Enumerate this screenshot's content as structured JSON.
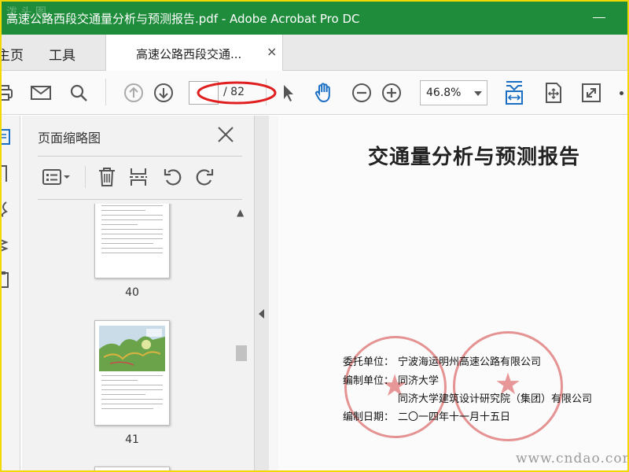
{
  "window": {
    "title": "高速公路西段交通量分析与预测报告.pdf - Adobe Acrobat Pro DC",
    "watermark": "泼 头 图"
  },
  "menubar": {
    "home_label": "主页",
    "tools_label": "工具",
    "tab_label": "高速公路西段交通...",
    "tab_close": "×"
  },
  "toolbar": {
    "page_total": "/ 82",
    "zoom": "46.8%",
    "icons": [
      "print-icon",
      "email-icon",
      "search-icon",
      "prev-page-icon",
      "next-page-icon",
      "select-arrow-icon",
      "hand-icon",
      "zoom-out-icon",
      "zoom-in-icon",
      "fit-width-icon",
      "fit-page-icon",
      "fullscreen-icon",
      "more-icon"
    ]
  },
  "panel": {
    "title": "页面缩略图",
    "icons": [
      "thumbnail-options-icon",
      "delete-icon",
      "extract-icon",
      "rotate-left-icon",
      "rotate-right-icon"
    ],
    "thumbnails": [
      {
        "number": "40"
      },
      {
        "number": "41"
      }
    ]
  },
  "document": {
    "title": "交通量分析与预测报告",
    "client_label": "委托单位：",
    "client_value": "宁波海运明州高速公路有限公司",
    "author_label": "编制单位：",
    "author_value1": "同济大学",
    "author_value2": "同济大学建筑设计研究院（集团）有限公司",
    "date_label": "编制日期：",
    "date_value": "二〇一四年十一月十五日"
  },
  "watermark_url": "www.cndao.com",
  "colors": {
    "titlebar": "#1e8c3a",
    "accent_blue": "#1a6fc4",
    "annotation_red": "#e02020",
    "stamp_red": "#d23c3c",
    "border": "#f0d800"
  }
}
